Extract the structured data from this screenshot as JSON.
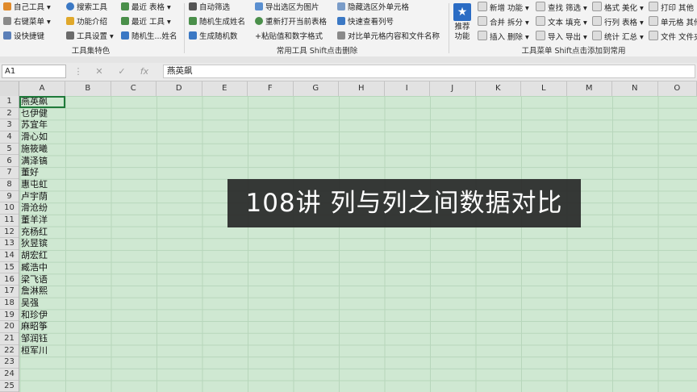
{
  "ribbon": {
    "group1": {
      "label": "工具集特色",
      "items": [
        "自己工具",
        "右键菜单",
        "设快捷键",
        "搜索工具",
        "功能介绍",
        "工具设置",
        "最近 表格",
        "最近 工具",
        "随机生...姓名"
      ]
    },
    "group2": {
      "label": "常用工具 Shift点击删除",
      "items": [
        "自动筛选",
        "随机生成姓名",
        "生成随机数",
        "导出选区为图片",
        "重新打开当前表格",
        "+粘贴值和数字格式",
        "隐藏选区外单元格",
        "快速查看列号",
        "对比单元格内容和文件名称"
      ]
    },
    "group3": {
      "label": "工具菜单 Shift点击添加到常用",
      "recommend": "推荐\n功能",
      "items": [
        "新增 功能",
        "合并 拆分",
        "插入 删除",
        "查找 筛选",
        "文本 填充",
        "导入 导出",
        "格式 美化",
        "行列 表格",
        "统计 汇总",
        "打印 其他",
        "单元格 其他",
        "文件 文件夹"
      ]
    }
  },
  "formula_bar": {
    "name_box": "A1",
    "content": "燕英飙"
  },
  "columns": [
    "A",
    "B",
    "C",
    "D",
    "E",
    "F",
    "G",
    "H",
    "I",
    "J",
    "K",
    "L",
    "M",
    "N",
    "O"
  ],
  "rows": [
    "1",
    "2",
    "3",
    "4",
    "5",
    "6",
    "7",
    "8",
    "9",
    "10",
    "11",
    "12",
    "13",
    "14",
    "15",
    "16",
    "17",
    "18",
    "19",
    "20",
    "21",
    "22",
    "23",
    "24",
    "25"
  ],
  "column_a": [
    "燕英飙",
    "乜伊健",
    "苏宜年",
    "滑心如",
    "施筱曦",
    "满泽镐",
    "董好",
    "惠屯虹",
    "卢宇荫",
    "滑沧纷",
    "董羊洋",
    "充杨红",
    "狄昱镔",
    "胡宏红",
    "臧浩中",
    "梁飞语",
    "詹淋熙",
    "吴强",
    "和珍伊",
    "麻昭筝",
    "邹润钰",
    "桓军川"
  ],
  "overlay_title": "108讲 列与列之间数据对比",
  "colors": {
    "sheet_bg": "#cfe8d2",
    "accent": "#1f7a3a",
    "ribbon_bg": "#f3f3f3"
  }
}
